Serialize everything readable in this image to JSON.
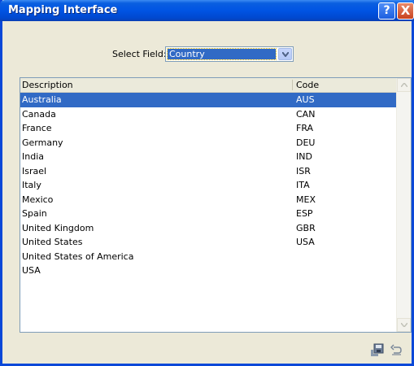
{
  "window": {
    "title": "Mapping Interface"
  },
  "titlebar": {
    "help_glyph": "?",
    "close_glyph": "X"
  },
  "select_field": {
    "label": "Select Field:",
    "value": "Country"
  },
  "list": {
    "columns": [
      "Description",
      "Code"
    ],
    "rows": [
      {
        "description": "Australia",
        "code": "AUS",
        "selected": true
      },
      {
        "description": "Canada",
        "code": "CAN"
      },
      {
        "description": "France",
        "code": "FRA"
      },
      {
        "description": "Germany",
        "code": "DEU"
      },
      {
        "description": "India",
        "code": "IND"
      },
      {
        "description": "Israel",
        "code": "ISR"
      },
      {
        "description": "Italy",
        "code": "ITA"
      },
      {
        "description": "Mexico",
        "code": "MEX"
      },
      {
        "description": "Spain",
        "code": "ESP"
      },
      {
        "description": "United Kingdom",
        "code": "GBR"
      },
      {
        "description": "United States",
        "code": "USA"
      },
      {
        "description": "United States of America",
        "code": ""
      },
      {
        "description": "USA",
        "code": ""
      }
    ]
  },
  "colors": {
    "titlebar": "#0054e3",
    "selection": "#316ac5",
    "window_bg": "#ece9d8"
  },
  "icons": [
    "help-icon",
    "close-icon",
    "dropdown-arrow-icon",
    "save-icon",
    "undo-icon"
  ]
}
